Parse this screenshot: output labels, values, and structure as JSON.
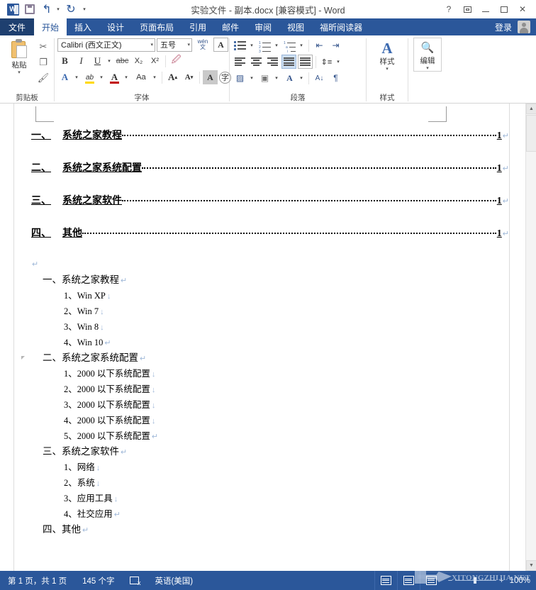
{
  "window": {
    "title": "实验文件 - 副本.docx [兼容模式] - Word",
    "quick_access": [
      {
        "name": "word-logo",
        "label": "W"
      },
      {
        "name": "save",
        "label": "保存"
      },
      {
        "name": "undo",
        "label": "撤消"
      },
      {
        "name": "redo",
        "label": "恢复"
      },
      {
        "name": "customize-qat",
        "label": "自定义快速访问工具栏"
      }
    ],
    "controls": {
      "help": "?",
      "ribbon_display": "功能区显示选项",
      "minimize": "最小化",
      "restore": "还原",
      "close": "✕"
    }
  },
  "tabs": {
    "file": "文件",
    "items": [
      {
        "label": "开始",
        "active": true
      },
      {
        "label": "插入",
        "active": false
      },
      {
        "label": "设计",
        "active": false
      },
      {
        "label": "页面布局",
        "active": false
      },
      {
        "label": "引用",
        "active": false
      },
      {
        "label": "邮件",
        "active": false
      },
      {
        "label": "审阅",
        "active": false
      },
      {
        "label": "视图",
        "active": false
      },
      {
        "label": "福昕阅读器",
        "active": false
      }
    ],
    "signin": "登录"
  },
  "ribbon": {
    "groups": [
      {
        "label": "剪贴板"
      },
      {
        "label": "字体"
      },
      {
        "label": "段落"
      },
      {
        "label": "样式"
      }
    ],
    "clipboard": {
      "paste_label": "粘贴",
      "cut": "剪切",
      "copy": "复制",
      "format_painter": "格式刷"
    },
    "font": {
      "family_value": "Calibri (西文正文)",
      "size_value": "五号",
      "bold": "B",
      "italic": "I",
      "underline": "U",
      "strikethrough": "abc",
      "subscript": "X₂",
      "superscript": "X²",
      "clear_formatting": "清除格式",
      "phonetic_guide": "wén 文",
      "char_border": "A",
      "text_effects": "A",
      "highlight": "ab",
      "font_color": "A",
      "change_case": "Aa",
      "grow_font": "A",
      "shrink_font": "A",
      "text_shading": "A",
      "char_shading": "字"
    },
    "paragraph": {
      "bullets": "项目符号",
      "numbering": "编号",
      "multilevel": "多级列表",
      "decrease_indent": "减少缩进量",
      "increase_indent": "增加缩进量",
      "align_left": "左对齐",
      "align_center": "居中",
      "align_right": "右对齐",
      "justify": "两端对齐",
      "distribute": "分散对齐",
      "line_spacing": "行和段落间距",
      "shading": "底纹",
      "borders": "边框",
      "asian_layout": "中文版式",
      "sort": "排序",
      "show_marks": "显示/隐藏编辑标记"
    },
    "styles": {
      "big_label": "样式"
    },
    "editing": {
      "big_label": "编辑"
    }
  },
  "document": {
    "toc": [
      {
        "num": "一、",
        "title": "系统之家教程",
        "page": "1",
        "mark": "↵"
      },
      {
        "num": "二、",
        "title": "系统之家系统配置",
        "page": "1",
        "mark": "↵"
      },
      {
        "num": "三、",
        "title": "系统之家软件",
        "page": "1",
        "mark": "↵"
      },
      {
        "num": "四、",
        "title": "其他",
        "page": "1",
        "mark": "↵"
      }
    ],
    "blank_mark": "↵",
    "body": [
      {
        "level": 1,
        "text": "一、系统之家教程",
        "mark": "↵",
        "collapse": false
      },
      {
        "level": 2,
        "text": "1、Win XP",
        "mark": "↓"
      },
      {
        "level": 2,
        "text": "2、Win 7",
        "mark": "↓"
      },
      {
        "level": 2,
        "text": "3、Win 8",
        "mark": "↓"
      },
      {
        "level": 2,
        "text": "4、Win 10",
        "mark": "↵"
      },
      {
        "level": 1,
        "text": "二、系统之家系统配置",
        "mark": "↵",
        "collapse": true
      },
      {
        "level": 2,
        "text": "1、2000 以下系统配置",
        "mark": "↓"
      },
      {
        "level": 2,
        "text": "2、2000 以下系统配置",
        "mark": "↓"
      },
      {
        "level": 2,
        "text": "3、2000 以下系统配置",
        "mark": "↓"
      },
      {
        "level": 2,
        "text": "4、2000 以下系统配置",
        "mark": "↓"
      },
      {
        "level": 2,
        "text": "5、2000 以下系统配置",
        "mark": "↵"
      },
      {
        "level": 1,
        "text": "三、系统之家软件",
        "mark": "↵",
        "collapse": false
      },
      {
        "level": 2,
        "text": "1、网络",
        "mark": "↓"
      },
      {
        "level": 2,
        "text": "2、系统",
        "mark": "↓"
      },
      {
        "level": 2,
        "text": "3、应用工具",
        "mark": "↓"
      },
      {
        "level": 2,
        "text": "4、社交应用",
        "mark": "↵"
      },
      {
        "level": 1,
        "text": "四、其他",
        "mark": "↵",
        "collapse": false
      }
    ]
  },
  "statusbar": {
    "page_info": "第 1 页，共 1 页",
    "word_count": "145 个字",
    "proofing": "校对",
    "language": "英语(美国)",
    "views": [
      {
        "name": "read-mode",
        "label": "阅读视图"
      },
      {
        "name": "print-layout",
        "label": "页面视图"
      },
      {
        "name": "web-layout",
        "label": "Web 版式视图"
      }
    ],
    "zoom_out": "−",
    "zoom_in": "+",
    "zoom_value": "100%"
  },
  "watermark": {
    "text": "XITONGZHIJIA.NET"
  },
  "colors": {
    "brand_blue": "#2b579a",
    "file_tab": "#1e3f6f",
    "accent_orange": "#f0c070",
    "mark_blue": "#9fb8d8"
  }
}
